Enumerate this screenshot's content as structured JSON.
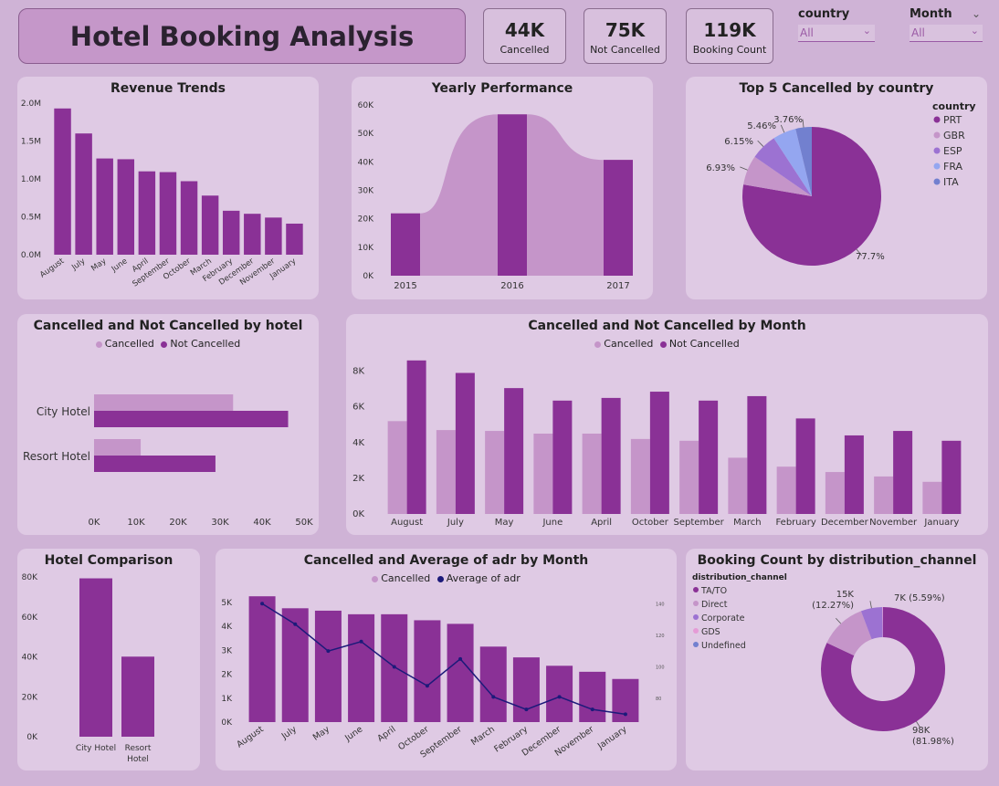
{
  "header": {
    "title": "Hotel Booking Analysis",
    "kpis": [
      {
        "value": "44K",
        "label": "Cancelled"
      },
      {
        "value": "75K",
        "label": "Not Cancelled"
      },
      {
        "value": "119K",
        "label": "Booking Count"
      }
    ],
    "slicers": [
      {
        "title": "country",
        "value": "All"
      },
      {
        "title": "Month",
        "value": "All"
      }
    ]
  },
  "colors": {
    "dark": "#8a3196",
    "light": "#c595c9",
    "navy": "#1c1a7a"
  },
  "chart_data": [
    {
      "id": "revenue",
      "type": "bar",
      "title": "Revenue Trends",
      "categories": [
        "August",
        "July",
        "May",
        "June",
        "April",
        "September",
        "October",
        "March",
        "February",
        "December",
        "November",
        "January"
      ],
      "values": [
        1.93,
        1.6,
        1.27,
        1.26,
        1.1,
        1.09,
        0.97,
        0.78,
        0.58,
        0.54,
        0.49,
        0.41
      ],
      "yticks": [
        "0.0M",
        "0.5M",
        "1.0M",
        "1.5M",
        "2.0M"
      ],
      "ylim": [
        0,
        2.0
      ]
    },
    {
      "id": "yearly",
      "type": "bar",
      "title": "Yearly Performance",
      "categories": [
        "2015",
        "2016",
        "2017"
      ],
      "values": [
        21.9,
        56.7,
        40.7
      ],
      "area_values": [
        21.9,
        56.7,
        40.7
      ],
      "yticks": [
        "0K",
        "10K",
        "20K",
        "30K",
        "40K",
        "50K",
        "60K"
      ],
      "ylim": [
        0,
        60
      ]
    },
    {
      "id": "top5",
      "type": "pie",
      "title": "Top 5 Cancelled by country",
      "legend_title": "country",
      "labels": [
        "PRT",
        "GBR",
        "ESP",
        "FRA",
        "ITA"
      ],
      "values": [
        77.7,
        6.93,
        6.15,
        5.46,
        3.76
      ],
      "value_labels": [
        "77.7%",
        "6.93%",
        "6.15%",
        "5.46%",
        "3.76%"
      ],
      "colors": [
        "#8a3196",
        "#c595c9",
        "#9c72d2",
        "#94a6f0",
        "#7280cf"
      ]
    },
    {
      "id": "hotel",
      "type": "bar",
      "title": "Cancelled and Not Cancelled by hotel",
      "categories": [
        "City Hotel",
        "Resort Hotel"
      ],
      "series": [
        {
          "name": "Cancelled",
          "values": [
            33.1,
            11.1
          ]
        },
        {
          "name": "Not Cancelled",
          "values": [
            46.2,
            28.9
          ]
        }
      ],
      "xticks": [
        "0K",
        "10K",
        "20K",
        "30K",
        "40K",
        "50K"
      ],
      "xlim": [
        0,
        50
      ]
    },
    {
      "id": "month",
      "type": "bar",
      "title": "Cancelled and Not Cancelled by Month",
      "categories": [
        "August",
        "July",
        "May",
        "June",
        "April",
        "October",
        "September",
        "March",
        "February",
        "December",
        "November",
        "January"
      ],
      "series": [
        {
          "name": "Cancelled",
          "values": [
            5.2,
            4.7,
            4.65,
            4.5,
            4.5,
            4.2,
            4.1,
            3.15,
            2.65,
            2.35,
            2.1,
            1.8
          ]
        },
        {
          "name": "Not Cancelled",
          "values": [
            8.6,
            7.9,
            7.05,
            6.35,
            6.5,
            6.85,
            6.35,
            6.6,
            5.35,
            4.4,
            4.65,
            4.1
          ]
        }
      ],
      "yticks": [
        "0K",
        "2K",
        "4K",
        "6K",
        "8K"
      ],
      "ylim": [
        0,
        9
      ]
    },
    {
      "id": "compare",
      "type": "bar",
      "title": "Hotel Comparison",
      "categories": [
        "City Hotel",
        "Resort Hotel"
      ],
      "values": [
        79.3,
        40.1
      ],
      "yticks": [
        "0K",
        "20K",
        "40K",
        "60K",
        "80K"
      ],
      "ylim": [
        0,
        80
      ]
    },
    {
      "id": "adr",
      "type": "bar",
      "title": "Cancelled and Average of adr by Month",
      "categories": [
        "August",
        "July",
        "May",
        "June",
        "April",
        "October",
        "September",
        "March",
        "February",
        "December",
        "November",
        "January"
      ],
      "series": [
        {
          "name": "Cancelled",
          "values": [
            5.25,
            4.75,
            4.65,
            4.5,
            4.5,
            4.25,
            4.1,
            3.15,
            2.7,
            2.35,
            2.1,
            1.8
          ]
        },
        {
          "name": "Average of adr",
          "values": [
            140,
            127,
            110,
            116,
            100,
            88,
            105,
            81,
            73,
            81,
            73,
            70
          ]
        }
      ],
      "yticks": [
        "0K",
        "1K",
        "2K",
        "3K",
        "4K",
        "5K"
      ],
      "ylim": [
        0,
        5.6
      ],
      "y2ticks": [
        "80",
        "100",
        "120",
        "140"
      ],
      "y2lim": [
        65,
        150
      ]
    },
    {
      "id": "channel",
      "type": "pie",
      "title": "Booking Count by distribution_channel",
      "legend_title": "distribution_channel",
      "labels": [
        "TA/TO",
        "Direct",
        "Corporate",
        "GDS",
        "Undefined"
      ],
      "values": [
        81.98,
        12.27,
        5.59,
        0.16,
        0.01
      ],
      "value_labels": [
        "98K\n(81.98%)",
        "15K\n(12.27%)",
        "7K (5.59%)",
        "",
        ""
      ],
      "colors": [
        "#8a3196",
        "#c595c9",
        "#9c72d2",
        "#e59bd6",
        "#7280cf"
      ]
    }
  ]
}
